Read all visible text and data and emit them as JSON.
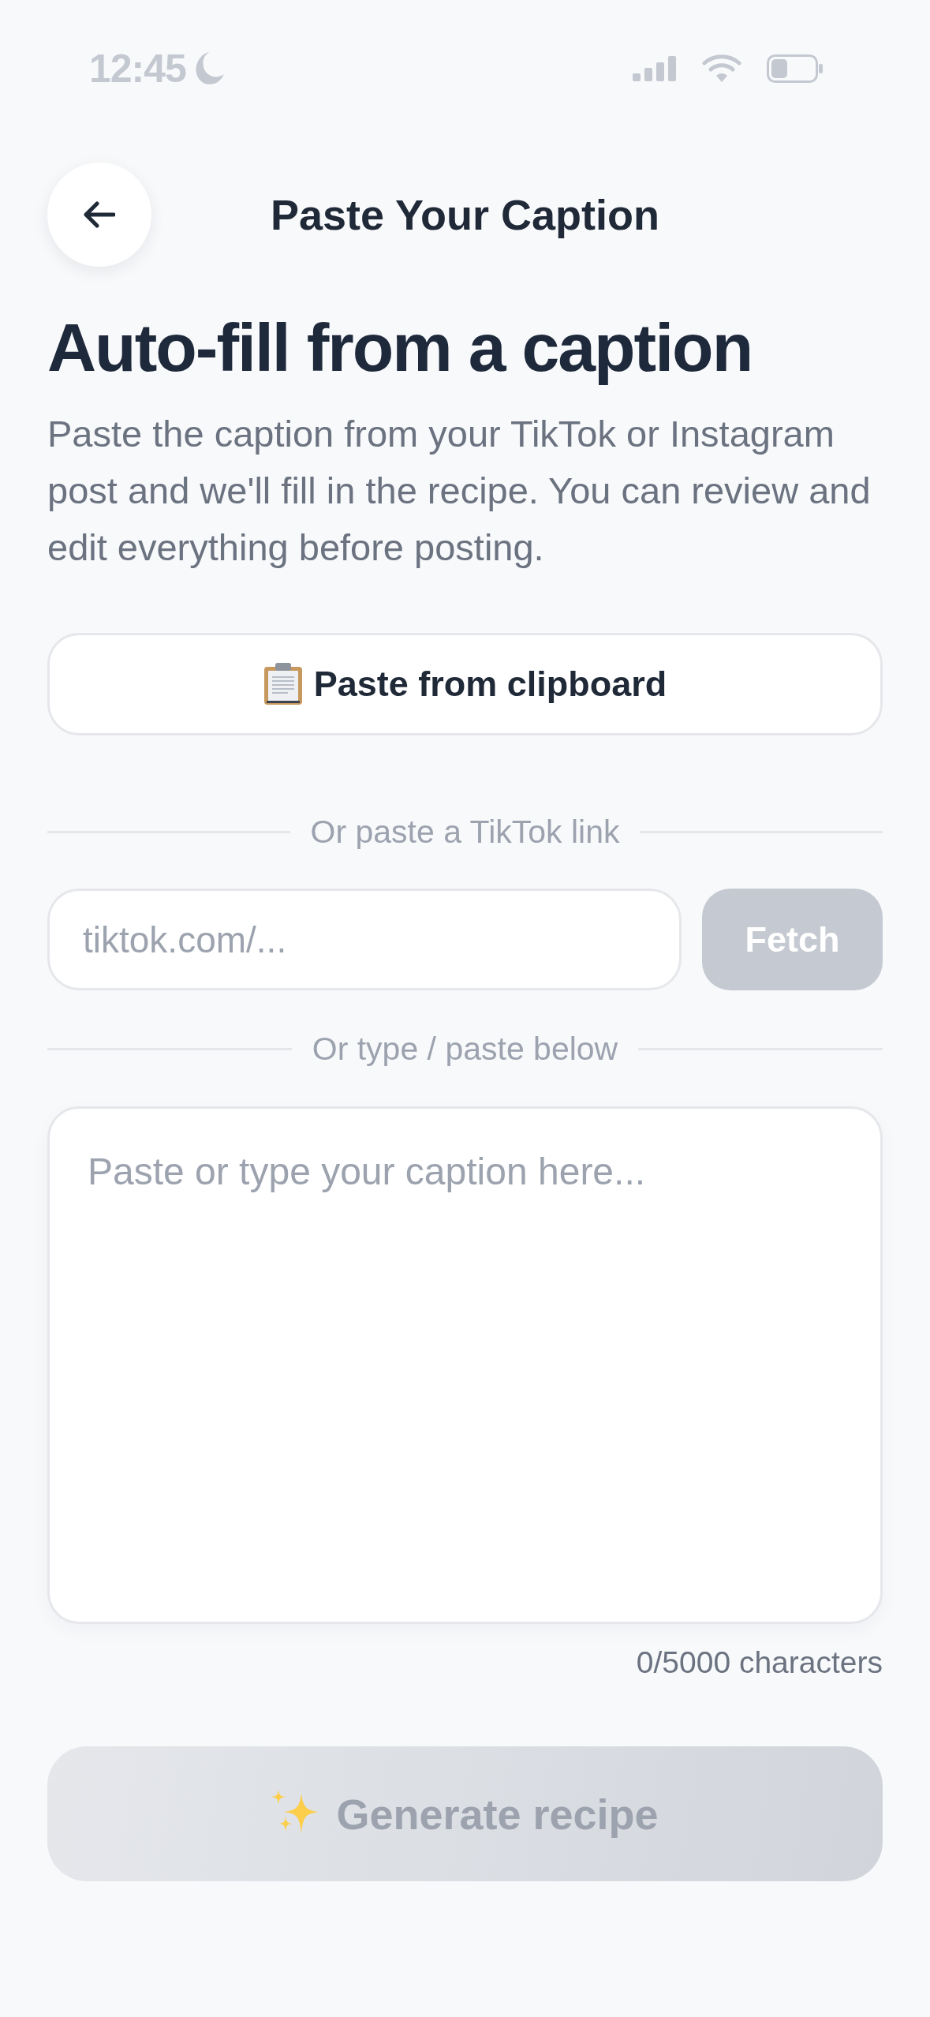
{
  "status_bar": {
    "time": "12:45"
  },
  "header": {
    "title": "Paste Your Caption"
  },
  "intro": {
    "heading": "Auto-fill from a caption",
    "text": "Paste the caption from your TikTok or Instagram post and we'll fill in the recipe. You can review and edit everything before posting."
  },
  "paste_button": {
    "label": "Paste from clipboard"
  },
  "link_section": {
    "divider": "Or paste a TikTok link",
    "field": {
      "placeholder": "tiktok.com/..."
    },
    "fetch_button": {
      "label": "Fetch",
      "disabled": true
    }
  },
  "caption_section": {
    "divider": "Or type / paste below",
    "field": {
      "placeholder": "Paste or type your caption here..."
    },
    "counter": "0/5000 characters"
  },
  "generate_button": {
    "label": "Generate recipe",
    "disabled": true
  }
}
